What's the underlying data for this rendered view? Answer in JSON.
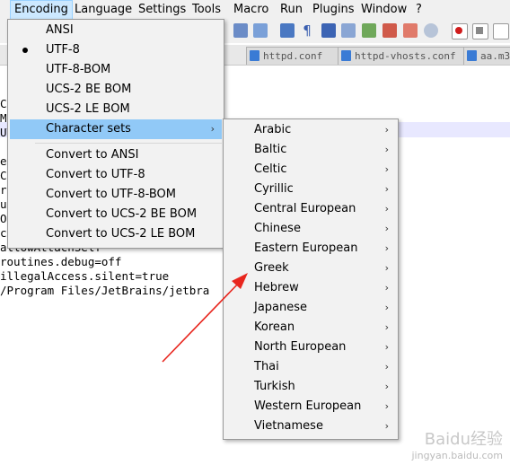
{
  "menubar": {
    "items": [
      "Encoding",
      "Language",
      "Settings",
      "Tools",
      "Macro",
      "Run",
      "Plugins",
      "Window",
      "?"
    ]
  },
  "tabs": [
    {
      "label": "httpd.conf"
    },
    {
      "label": "httpd-vhosts.conf"
    },
    {
      "label": "aa.m3"
    }
  ],
  "editor": {
    "lines": [
      "Co",
      "Ma",
      "UT",
      "er",
      "Ca",
      "re",
      "ut",
      "OC",
      "ck",
      "  allowAttachSelf",
      "routines.debug=off",
      " illegalAccess.silent=true",
      " /Program Files/JetBrains/jetbra"
    ]
  },
  "encoding_menu": {
    "items": [
      {
        "label": "ANSI"
      },
      {
        "label": "UTF-8",
        "checked": true
      },
      {
        "label": "UTF-8-BOM"
      },
      {
        "label": "UCS-2 BE BOM"
      },
      {
        "label": "UCS-2 LE BOM"
      },
      {
        "label": "Character sets",
        "submenu": true,
        "highlighted": true
      },
      {
        "label": "Convert to ANSI"
      },
      {
        "label": "Convert to UTF-8"
      },
      {
        "label": "Convert to UTF-8-BOM"
      },
      {
        "label": "Convert to UCS-2 BE BOM"
      },
      {
        "label": "Convert to UCS-2 LE BOM"
      }
    ]
  },
  "charset_menu": {
    "items": [
      "Arabic",
      "Baltic",
      "Celtic",
      "Cyrillic",
      "Central European",
      "Chinese",
      "Eastern European",
      "Greek",
      "Hebrew",
      "Japanese",
      "Korean",
      "North European",
      "Thai",
      "Turkish",
      "Western European",
      "Vietnamese"
    ]
  },
  "watermark": {
    "line1": "Baidu经验",
    "line2": "jingyan.baidu.com"
  },
  "colors": {
    "menu_bg": "#f2f2f2",
    "menu_highlight": "#91c9f7",
    "menubar_active": "#cce8ff",
    "arrow": "#e8261e"
  }
}
